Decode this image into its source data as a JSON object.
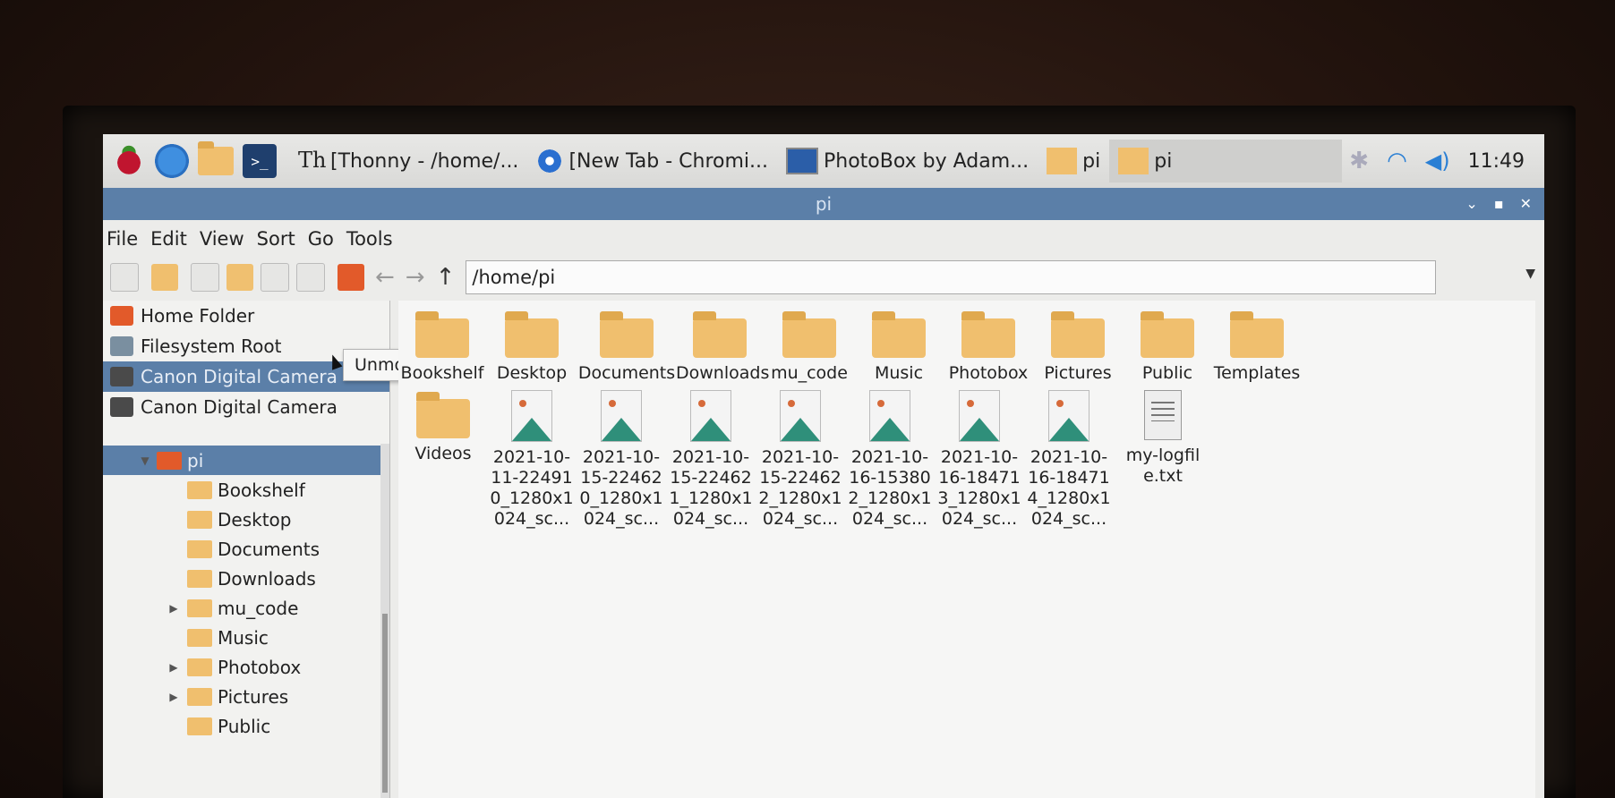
{
  "taskbar": {
    "tasks": [
      {
        "label": "[Thonny  -  /home/...",
        "icon": "thonny-icon"
      },
      {
        "label": "[New Tab - Chromi...",
        "icon": "chromium-icon"
      },
      {
        "label": "PhotoBox by Adam...",
        "icon": "window-icon"
      },
      {
        "label": "pi",
        "icon": "folder-icon"
      },
      {
        "label": "pi",
        "icon": "folder-icon"
      }
    ],
    "clock": "11:49"
  },
  "window": {
    "title": "pi",
    "menu": [
      "File",
      "Edit",
      "View",
      "Sort",
      "Go",
      "Tools"
    ],
    "path": "/home/pi"
  },
  "places": [
    {
      "label": "Home Folder",
      "icon": "home-icon"
    },
    {
      "label": "Filesystem Root",
      "icon": "drive-icon"
    },
    {
      "label": "Canon Digital Camera",
      "icon": "camera-icon"
    },
    {
      "label": "Canon Digital Camera",
      "icon": "camera-icon"
    }
  ],
  "tooltip": "Unmount Volume",
  "tree": {
    "root": "pi",
    "items": [
      "Bookshelf",
      "Desktop",
      "Documents",
      "Downloads",
      "mu_code",
      "Music",
      "Photobox",
      "Pictures",
      "Public"
    ]
  },
  "files": [
    {
      "name": "Bookshelf",
      "type": "folder"
    },
    {
      "name": "Desktop",
      "type": "folder"
    },
    {
      "name": "Documents",
      "type": "folder"
    },
    {
      "name": "Downloads",
      "type": "folder"
    },
    {
      "name": "mu_code",
      "type": "folder"
    },
    {
      "name": "Music",
      "type": "folder"
    },
    {
      "name": "Photobox",
      "type": "folder"
    },
    {
      "name": "Pictures",
      "type": "folder"
    },
    {
      "name": "Public",
      "type": "folder"
    },
    {
      "name": "Templates",
      "type": "folder"
    },
    {
      "name": "Videos",
      "type": "folder"
    },
    {
      "name": "2021-10-11-224910_1280x1024_sc...",
      "type": "image"
    },
    {
      "name": "2021-10-15-224620_1280x1024_sc...",
      "type": "image"
    },
    {
      "name": "2021-10-15-224621_1280x1024_sc...",
      "type": "image"
    },
    {
      "name": "2021-10-15-224622_1280x1024_sc...",
      "type": "image"
    },
    {
      "name": "2021-10-16-153802_1280x1024_sc...",
      "type": "image"
    },
    {
      "name": "2021-10-16-184713_1280x1024_sc...",
      "type": "image"
    },
    {
      "name": "2021-10-16-184714_1280x1024_sc...",
      "type": "image"
    },
    {
      "name": "my-logfile.txt",
      "type": "text"
    }
  ]
}
